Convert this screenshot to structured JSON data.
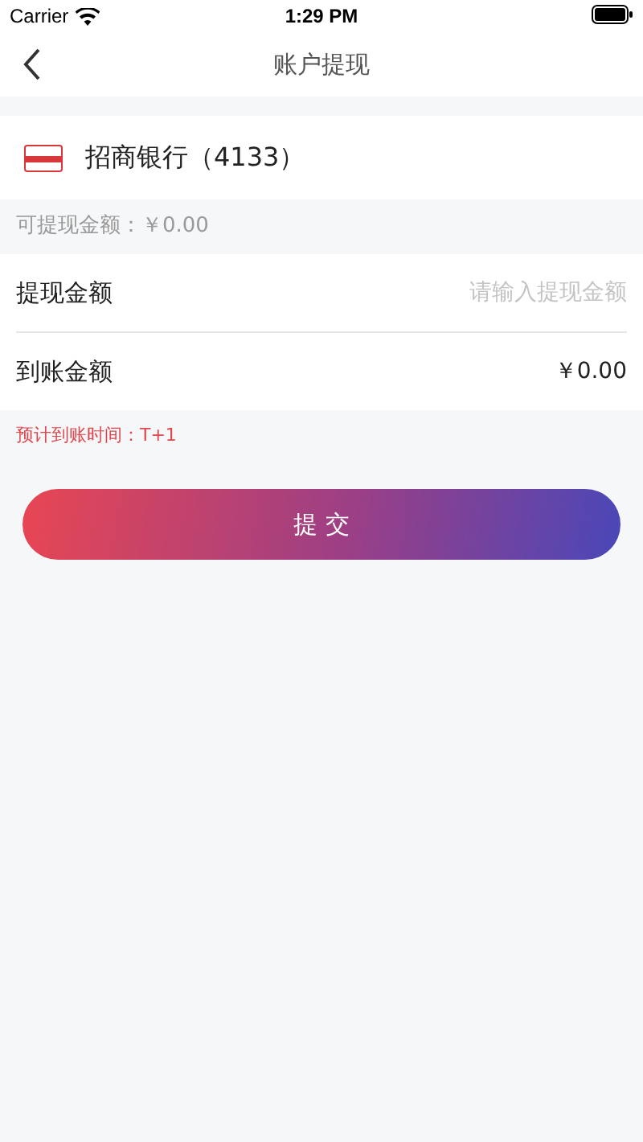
{
  "status_bar": {
    "carrier": "Carrier",
    "time": "1:29 PM"
  },
  "nav": {
    "title": "账户提现"
  },
  "bank": {
    "name": "招商银行（4133）"
  },
  "available": "可提现金额：￥0.00",
  "form": {
    "amount_label": "提现金额",
    "amount_placeholder": "请输入提现金额",
    "received_label": "到账金额",
    "received_value": "￥0.00"
  },
  "note": "预计到账时间：T+1",
  "submit": "提 交"
}
